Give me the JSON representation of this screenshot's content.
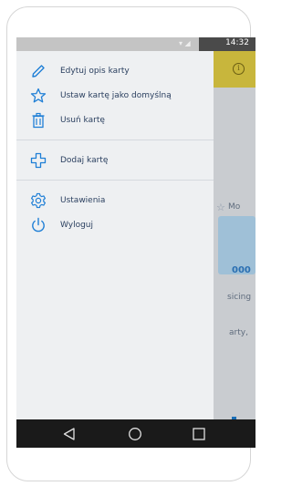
{
  "status_bar": {
    "time": "14:32"
  },
  "drawer": {
    "items": [
      {
        "label": "Edytuj opis karty",
        "icon": "pencil-icon"
      },
      {
        "label": "Ustaw kartę jako domyślną",
        "icon": "star-icon"
      },
      {
        "label": "Usuń kartę",
        "icon": "trash-icon"
      },
      {
        "label": "Dodaj kartę",
        "icon": "plus-icon"
      },
      {
        "label": "Ustawienia",
        "icon": "gear-icon"
      },
      {
        "label": "Wyloguj",
        "icon": "power-icon"
      }
    ]
  },
  "background_app": {
    "text_1": "Mo",
    "card_amount": "000",
    "text_2": "sicing",
    "text_3": "arty,"
  },
  "colors": {
    "accent": "#1f7fd6",
    "drawer_bg": "#eef0f2",
    "toolbar": "#c8b63c"
  }
}
